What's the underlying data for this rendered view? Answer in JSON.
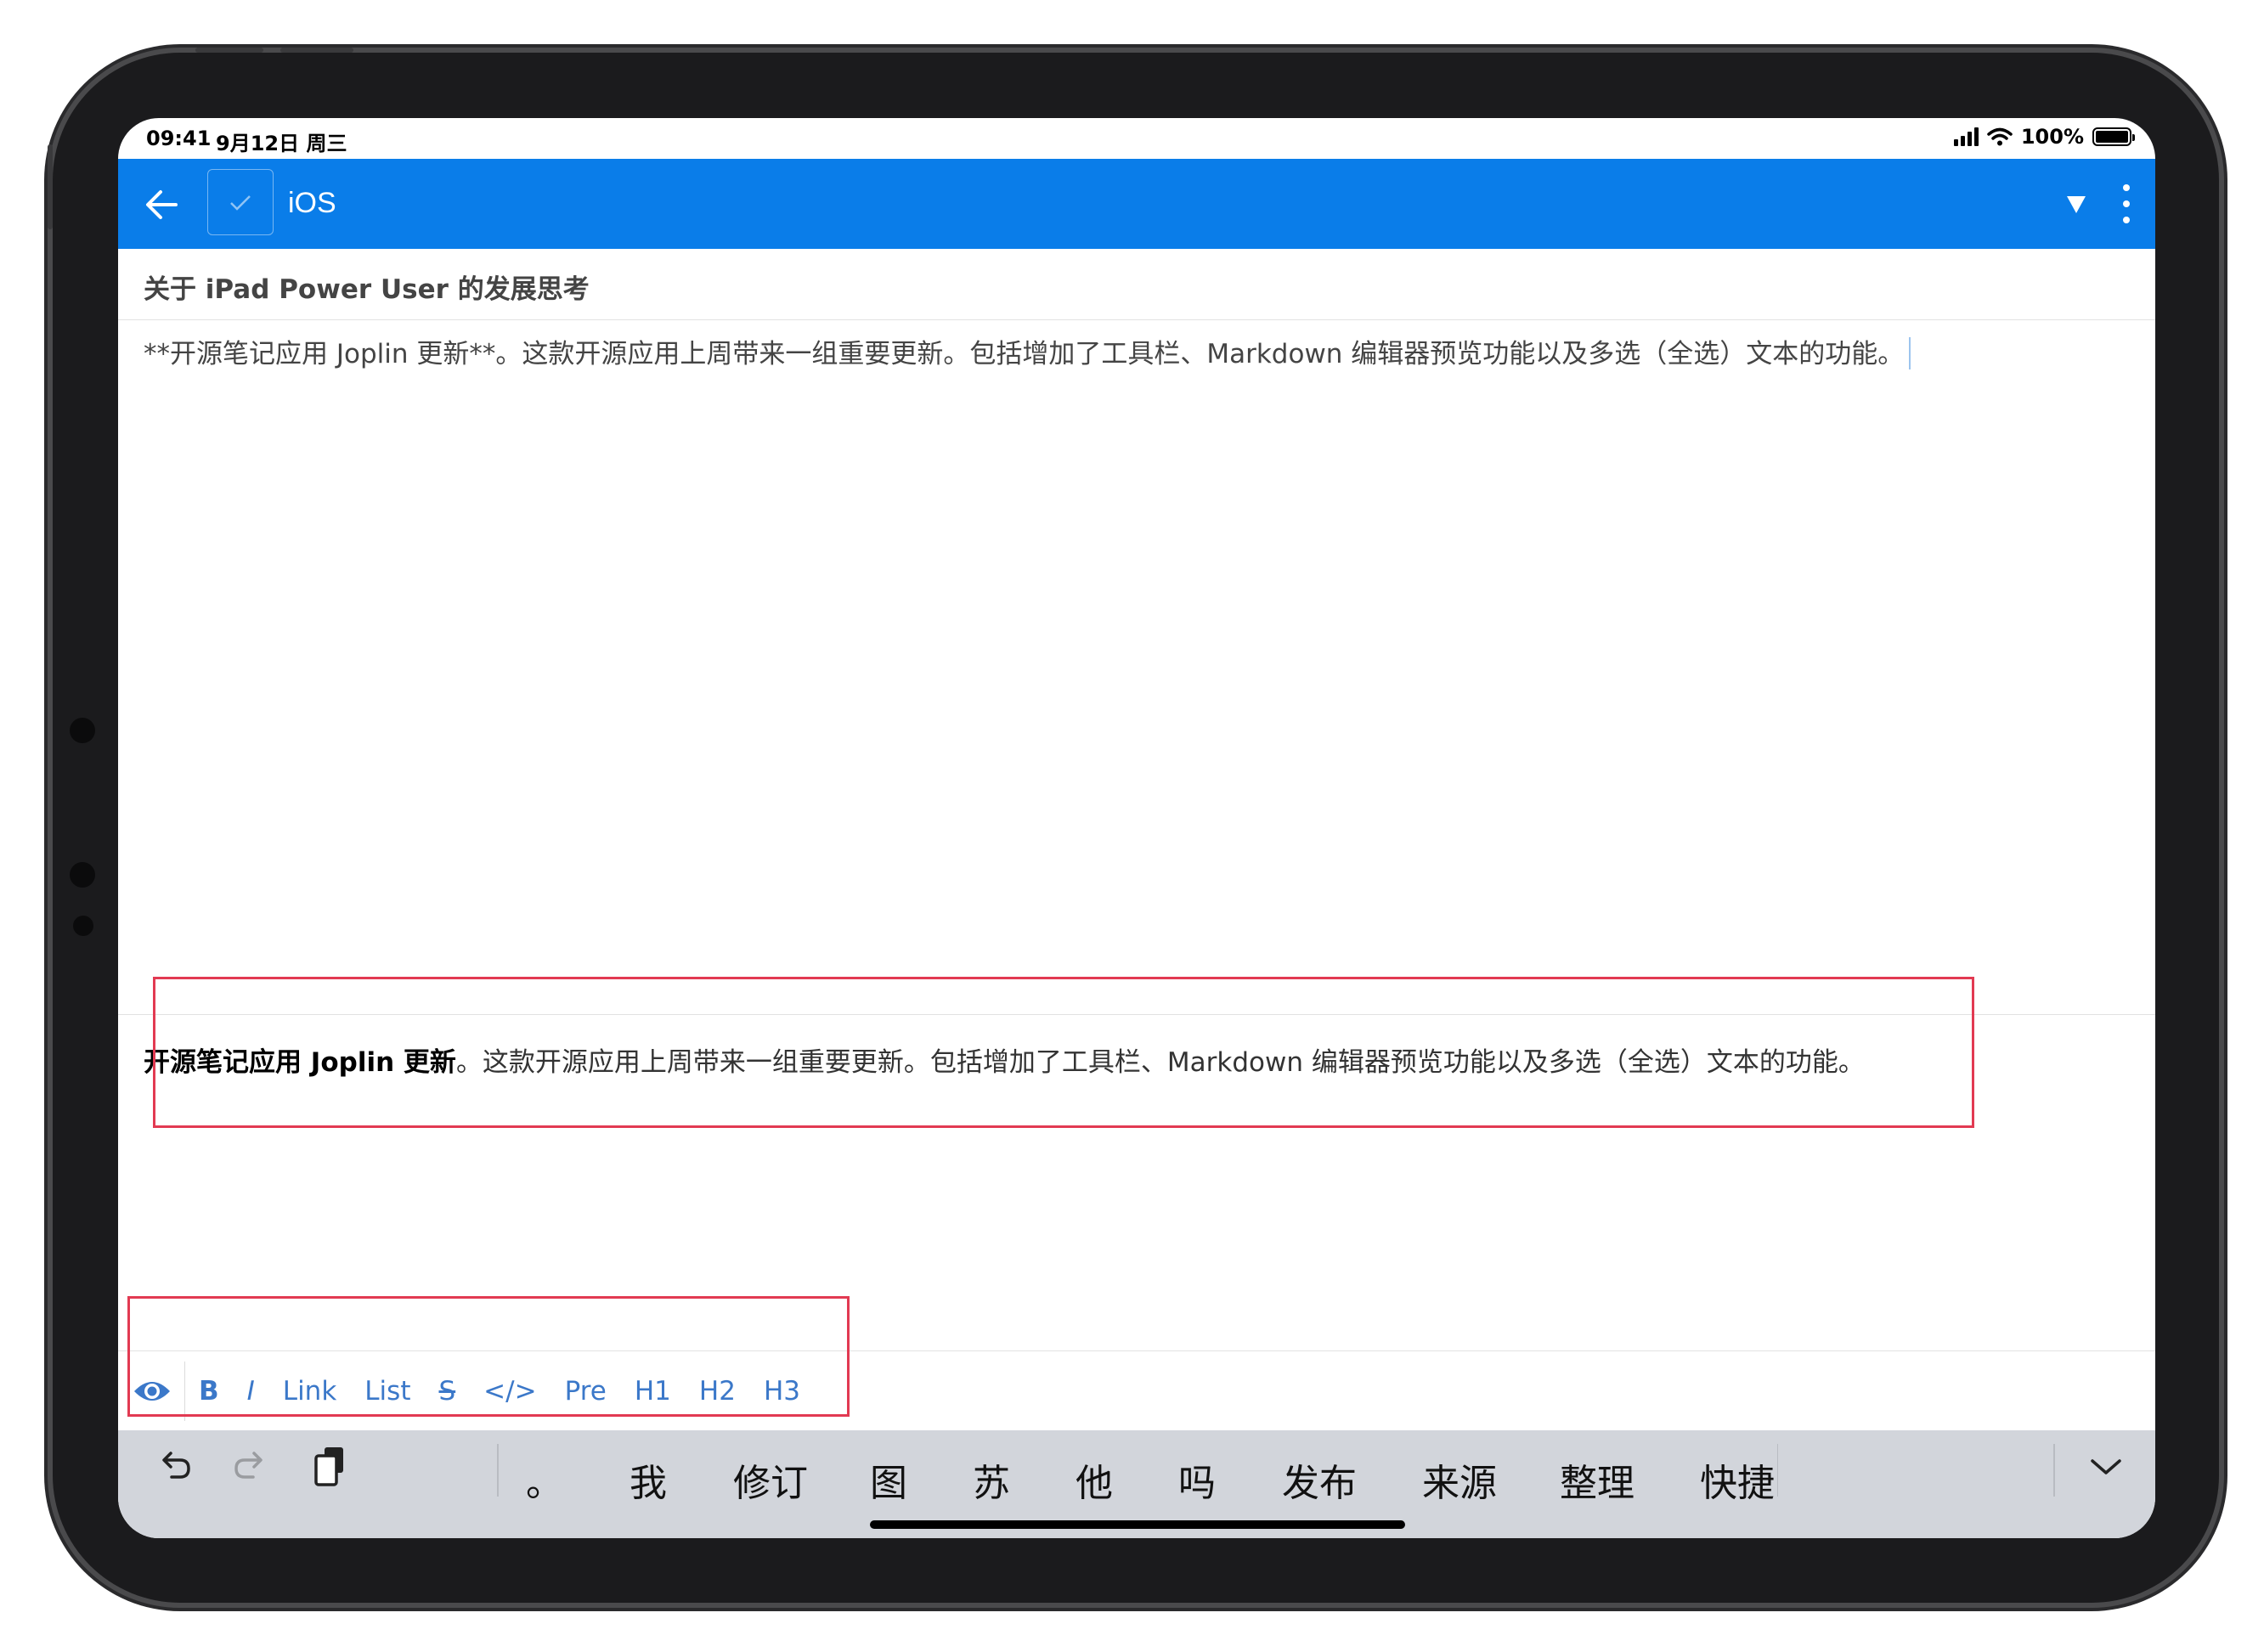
{
  "status": {
    "time": "09:41",
    "date": "9月12日 周三",
    "battery": "100%"
  },
  "header": {
    "folder_title": "iOS",
    "back_icon": "arrow-left-icon",
    "dropdown_icon": "triangle-down-icon",
    "menu_icon": "more-vertical-icon"
  },
  "note": {
    "title": "关于 iPad Power User 的发展思考",
    "body": "**开源笔记应用 Joplin 更新**。这款开源应用上周带来一组重要更新。包括增加了工具栏、Markdown 编辑器预览功能以及多选（全选）文本的功能。"
  },
  "preview": {
    "bold": "开源笔记应用 Joplin 更新",
    "rest": "。这款开源应用上周带来一组重要更新。包括增加了工具栏、Markdown 编辑器预览功能以及多选（全选）文本的功能。"
  },
  "toolbar": {
    "bold": "B",
    "italic": "I",
    "link": "Link",
    "list": "List",
    "strike": "S",
    "code": "</>",
    "pre": "Pre",
    "h1": "H1",
    "h2": "H2",
    "h3": "H3"
  },
  "keyboard": {
    "candidates": [
      "。",
      "我",
      "修订",
      "图",
      "苏",
      "他",
      "吗",
      "发布",
      "来源",
      "整理",
      "快捷"
    ]
  },
  "colors": {
    "header": "#0a7de9",
    "toolbar_text": "#3b78c9",
    "annotation": "#e23a52",
    "keyboard_bg": "#d2d5db"
  }
}
